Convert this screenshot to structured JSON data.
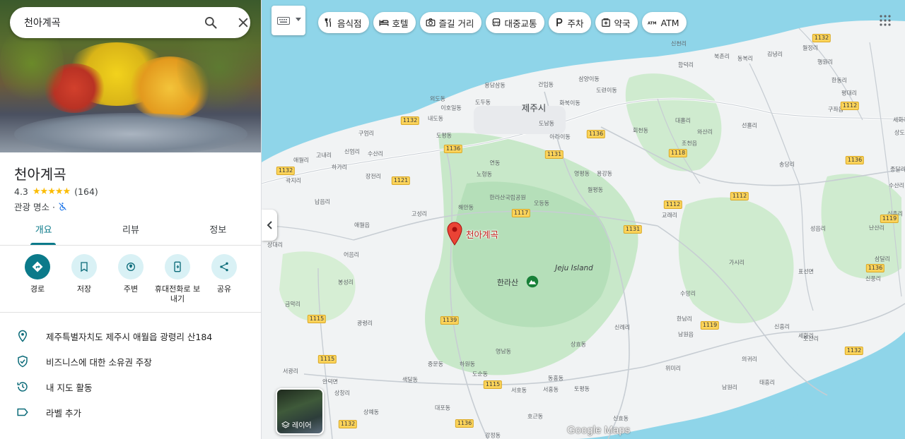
{
  "search": {
    "value": "천아계곡"
  },
  "place": {
    "title": "천아계곡",
    "rating": "4.3",
    "stars": "★★★★★",
    "reviews": "(164)",
    "category": "관광 명소 ·"
  },
  "tabs": [
    {
      "label": "개요",
      "active": true
    },
    {
      "label": "리뷰",
      "active": false
    },
    {
      "label": "정보",
      "active": false
    }
  ],
  "actions": [
    {
      "label": "경로"
    },
    {
      "label": "저장"
    },
    {
      "label": "주변"
    },
    {
      "label": "휴대전화로 보내기"
    },
    {
      "label": "공유"
    }
  ],
  "info": [
    {
      "label": "제주특별자치도 제주시 애월읍 광령리 산184"
    },
    {
      "label": "비즈니스에 대한 소유권 주장"
    },
    {
      "label": "내 지도 활동"
    },
    {
      "label": "라벨 추가"
    }
  ],
  "chips": [
    {
      "label": "음식점",
      "icon": "fork-knife-icon"
    },
    {
      "label": "호텔",
      "icon": "bed-icon"
    },
    {
      "label": "즐길 거리",
      "icon": "camera-icon"
    },
    {
      "label": "대중교통",
      "icon": "bus-icon"
    },
    {
      "label": "주차",
      "icon": "parking-icon"
    },
    {
      "label": "약국",
      "icon": "pharmacy-icon"
    },
    {
      "label": "ATM",
      "icon": "atm-icon"
    }
  ],
  "map": {
    "pin_label": "천아계곡",
    "layer_label": "레이어",
    "google_logo": "Google Maps",
    "city": "제주시",
    "mountain": "한라산",
    "island": "Jeju Island",
    "places": [
      "도두동",
      "용담삼동",
      "건입동",
      "삼양이동",
      "도련이동",
      "이호일동",
      "내도동",
      "화북이동",
      "도남동",
      "아라이동",
      "구엄리",
      "도평동",
      "회천동",
      "조천읍",
      "고내리",
      "신엄리",
      "수산리",
      "애월리",
      "하가리",
      "장전리",
      "노형동",
      "연동",
      "영평동",
      "용강동",
      "곽지리",
      "월평동",
      "납읍리",
      "해안동",
      "오등동",
      "고성리",
      "교래리",
      "상대리",
      "애월읍",
      "어음리",
      "봉성리",
      "금악리",
      "광령리",
      "중문동",
      "하원동",
      "도순동",
      "색달동",
      "서호동",
      "서홍동",
      "토평동",
      "상창리",
      "안덕면",
      "서광리",
      "대포동",
      "호근동",
      "신효동",
      "상예동",
      "강정동",
      "영남동",
      "상효동",
      "동홍동",
      "신례리",
      "남원읍",
      "한남리",
      "수망리",
      "가시리",
      "표선면",
      "토산리",
      "세화리",
      "위미리",
      "남원리",
      "태흥리",
      "의귀리",
      "신흥리",
      "함덕리",
      "북촌리",
      "동복리",
      "김녕리",
      "월정리",
      "행원리",
      "한동리",
      "평대리",
      "구좌읍",
      "세화리",
      "상도리",
      "선흘리",
      "와산리",
      "대흘리",
      "송당리",
      "수산리",
      "성읍리",
      "난산리",
      "삼달리",
      "신풍리",
      "신천리",
      "신촌리",
      "외도동",
      "종달리",
      "한라산국립공원"
    ],
    "routes": [
      "1132",
      "1136",
      "1131",
      "1117",
      "1121",
      "1136",
      "1118",
      "1112",
      "1112",
      "1131",
      "1139",
      "1115",
      "1115",
      "1115",
      "1119",
      "1132",
      "1136",
      "1119",
      "1112",
      "1132",
      "1136",
      "1132",
      "1132",
      "1136"
    ]
  }
}
